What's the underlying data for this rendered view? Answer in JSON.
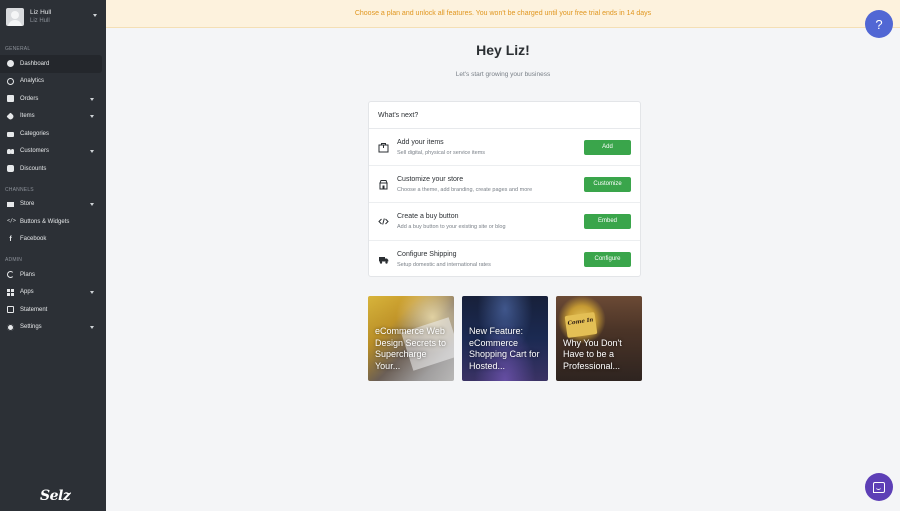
{
  "user": {
    "name": "Liz Hull",
    "subtitle": "Liz Hull"
  },
  "sidebar": {
    "sections": [
      {
        "label": "General",
        "items": [
          {
            "label": "Dashboard",
            "icon": "dashboard-icon",
            "active": true
          },
          {
            "label": "Analytics",
            "icon": "analytics-icon"
          },
          {
            "label": "Orders",
            "icon": "orders-icon",
            "expandable": true
          },
          {
            "label": "Items",
            "icon": "tag-icon",
            "expandable": true
          },
          {
            "label": "Categories",
            "icon": "folder-icon"
          },
          {
            "label": "Customers",
            "icon": "people-icon",
            "expandable": true
          },
          {
            "label": "Discounts",
            "icon": "badge-icon"
          }
        ]
      },
      {
        "label": "Channels",
        "items": [
          {
            "label": "Store",
            "icon": "store-icon",
            "expandable": true
          },
          {
            "label": "Buttons & Widgets",
            "icon": "code-icon"
          },
          {
            "label": "Facebook",
            "icon": "facebook-icon"
          }
        ]
      },
      {
        "label": "Admin",
        "items": [
          {
            "label": "Plans",
            "icon": "refresh-icon"
          },
          {
            "label": "Apps",
            "icon": "apps-icon",
            "expandable": true
          },
          {
            "label": "Statement",
            "icon": "statement-icon"
          },
          {
            "label": "Settings",
            "icon": "gear-icon",
            "expandable": true
          }
        ]
      }
    ],
    "logo": "Selz"
  },
  "banner": {
    "text": "Choose a plan and unlock all features. You won't be charged until your free trial ends in 14 days"
  },
  "help": {
    "label": "?"
  },
  "greeting": {
    "title": "Hey Liz!",
    "subtitle": "Let's start growing your business"
  },
  "next_steps": {
    "header": "What's next?",
    "tasks": [
      {
        "title": "Add your items",
        "desc": "Sell digital, physical or service items",
        "button": "Add",
        "icon": "box-icon"
      },
      {
        "title": "Customize your store",
        "desc": "Choose a theme, add branding, create pages and more",
        "button": "Customize",
        "icon": "store-icon"
      },
      {
        "title": "Create a buy button",
        "desc": "Add a buy button to your existing site or blog",
        "button": "Embed",
        "icon": "code-icon"
      },
      {
        "title": "Configure Shipping",
        "desc": "Setup domestic and international rates",
        "button": "Configure",
        "icon": "truck-icon"
      }
    ]
  },
  "articles": [
    {
      "title": "eCommerce Web Design Secrets to Supercharge Your..."
    },
    {
      "title": "New Feature: eCommerce Shopping Cart for Hosted..."
    },
    {
      "title": "Why You Don't Have to be a Professional..."
    }
  ],
  "colors": {
    "accent": "#3aa54b",
    "help": "#5167d4",
    "chat": "#5d3fb6",
    "banner_text": "#e0961f",
    "sidebar": "#2c3036"
  }
}
